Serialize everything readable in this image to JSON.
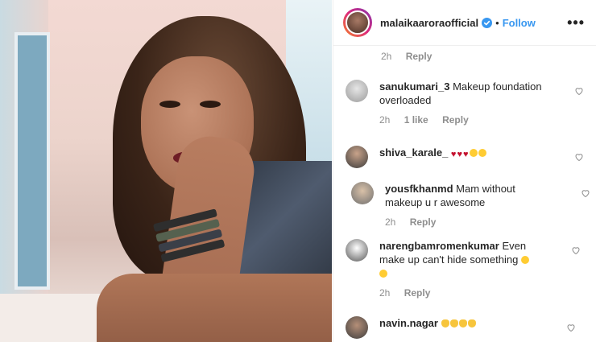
{
  "header": {
    "username": "malaikaaroraofficial",
    "separator": "•",
    "follow_label": "Follow",
    "more_label": "•••"
  },
  "first_meta": {
    "time": "2h",
    "reply": "Reply"
  },
  "comments": [
    {
      "username": "sanukumari_3",
      "text": "Makeup foundation overloaded",
      "time": "2h",
      "likes": "1 like",
      "reply": "Reply"
    },
    {
      "username": "shiva_karale_",
      "text": "",
      "emoji": [
        "heart",
        "heart",
        "heart",
        "heart-eyes",
        "heart-eyes"
      ]
    },
    {
      "username": "yousfkhanmd",
      "text": "Mam without makeup u r awesome",
      "time": "2h",
      "reply": "Reply"
    },
    {
      "username": "narengbamromenkumar",
      "text": "Even make up can't hide something",
      "time": "2h",
      "reply": "Reply",
      "emoji": [
        "tongue-face",
        "tongue-face"
      ]
    },
    {
      "username": "navin.nagar",
      "text": "",
      "emoji": [
        "hand",
        "hand",
        "hand",
        "hand"
      ]
    }
  ],
  "colors": {
    "accent": "#3897f0",
    "text": "#262626",
    "muted": "#8e8e8e",
    "divider": "#efefef"
  },
  "icons": [
    "verified-badge-icon",
    "more-options-icon",
    "heart-icon"
  ]
}
